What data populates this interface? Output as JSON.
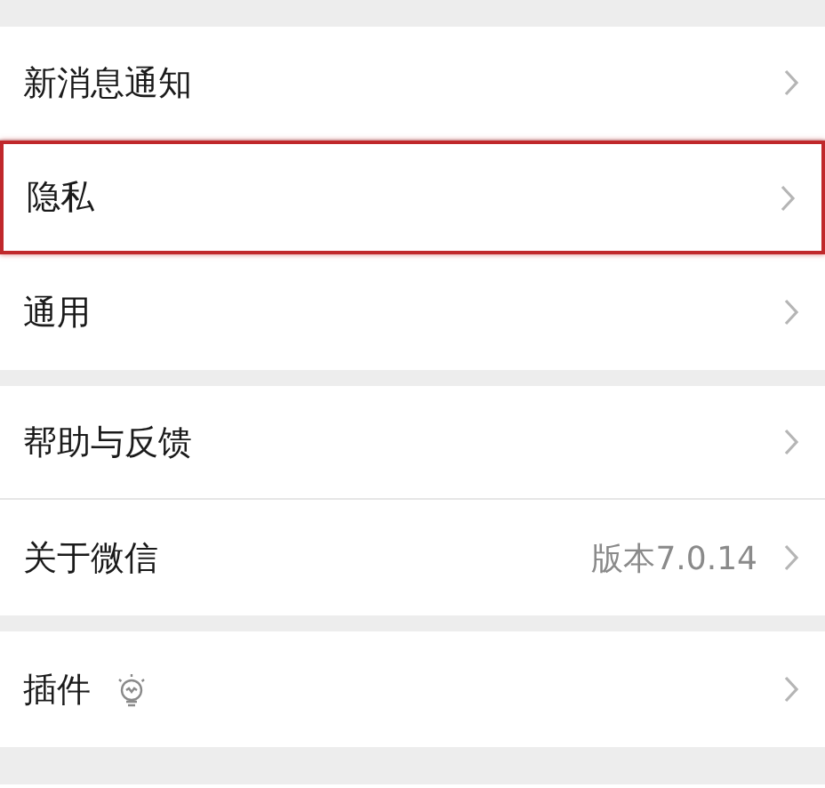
{
  "groups": [
    {
      "items": [
        {
          "kind": "plain",
          "label": "新消息通知",
          "highlighted": false
        },
        {
          "kind": "plain",
          "label": "隐私",
          "highlighted": true
        },
        {
          "kind": "plain",
          "label": "通用",
          "highlighted": false
        }
      ]
    },
    {
      "items": [
        {
          "kind": "plain",
          "label": "帮助与反馈",
          "highlighted": false
        },
        {
          "kind": "detail",
          "label": "关于微信",
          "detail": "版本7.0.14",
          "highlighted": false
        }
      ]
    },
    {
      "items": [
        {
          "kind": "icon",
          "label": "插件",
          "highlighted": false
        }
      ]
    }
  ]
}
